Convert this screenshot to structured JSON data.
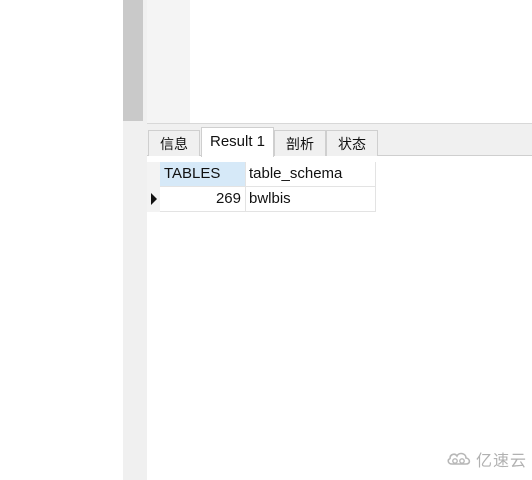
{
  "tabs": [
    {
      "label": "信息",
      "active": false
    },
    {
      "label": "Result 1",
      "active": true
    },
    {
      "label": "剖析",
      "active": false
    },
    {
      "label": "状态",
      "active": false
    }
  ],
  "grid": {
    "columns": [
      "TABLES",
      "table_schema"
    ],
    "selected_column": "TABLES",
    "rows": [
      {
        "TABLES": "269",
        "table_schema": "bwlbis",
        "current": true
      }
    ]
  },
  "watermark": {
    "logo_icon": "cloud-logo-icon",
    "text": "亿速云"
  },
  "colors": {
    "tab_strip": "#f0f0f0",
    "selected_header": "#d6e9f8",
    "splitter": "#f0f0f0",
    "splitter_thumb": "#c9c9c9",
    "watermark": "#a9a9a9"
  }
}
